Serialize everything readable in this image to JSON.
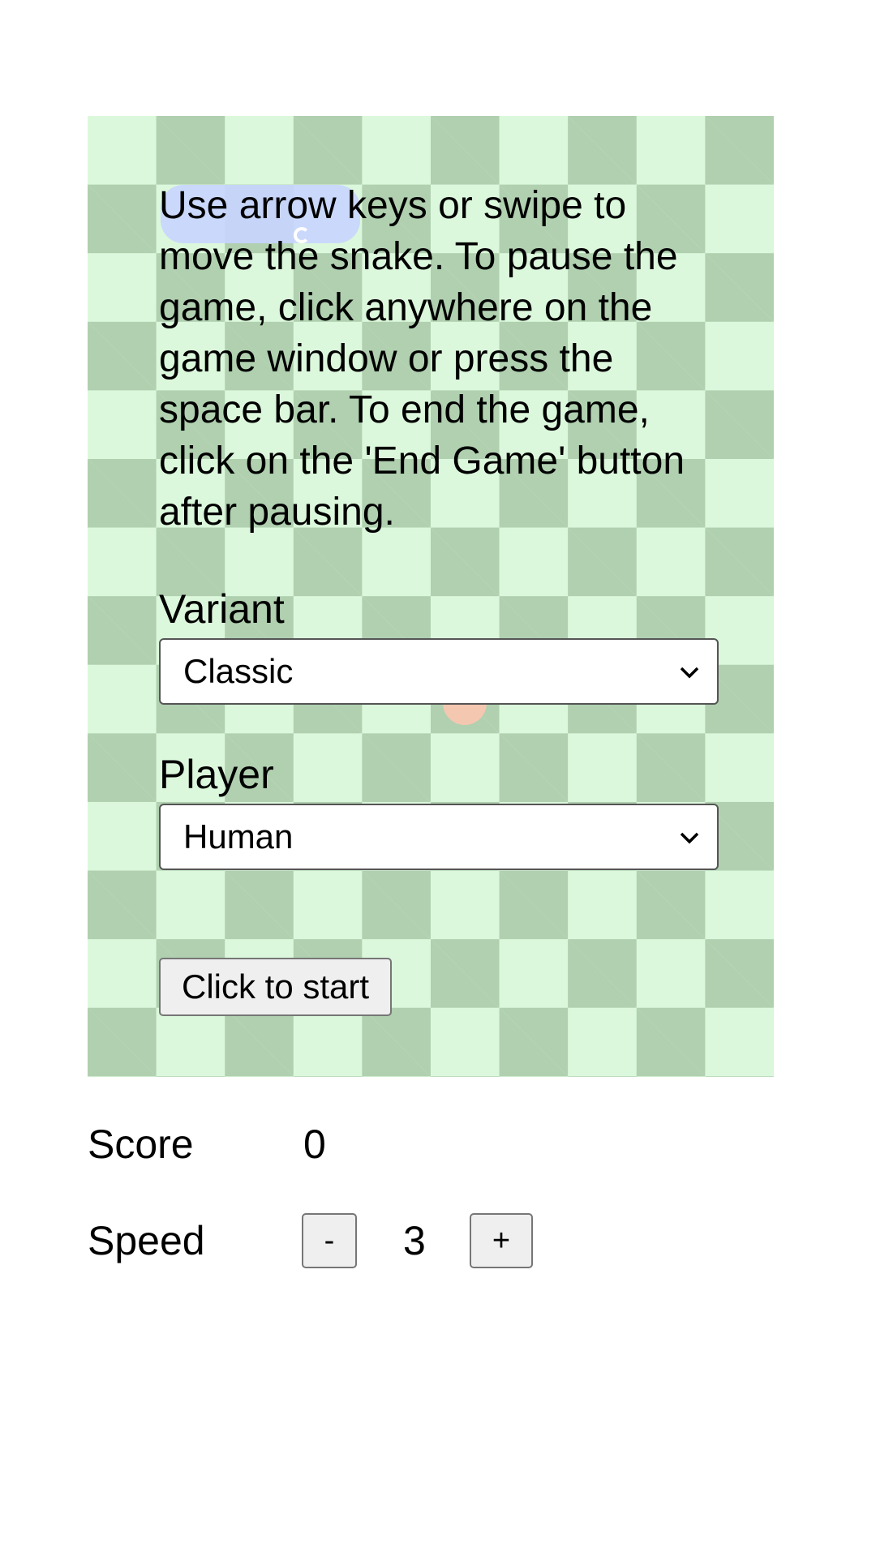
{
  "game": {
    "instructions": "Use arrow keys or swipe to move the snake. To pause the game, click anywhere on the game window or press the space bar. To end the game, click on the 'End Game' button after pausing.",
    "variant": {
      "label": "Variant",
      "selected": "Classic"
    },
    "player": {
      "label": "Player",
      "selected": "Human"
    },
    "start_label": "Click to start"
  },
  "stats": {
    "score_label": "Score",
    "score_value": "0",
    "speed_label": "Speed",
    "speed_value": "3",
    "decrease_label": "-",
    "increase_label": "+"
  },
  "colors": {
    "board_light": "#dcf8dc",
    "board_dark": "#b0d0b0",
    "snake": "#c8d4ff",
    "food": "#f3c7b0"
  }
}
